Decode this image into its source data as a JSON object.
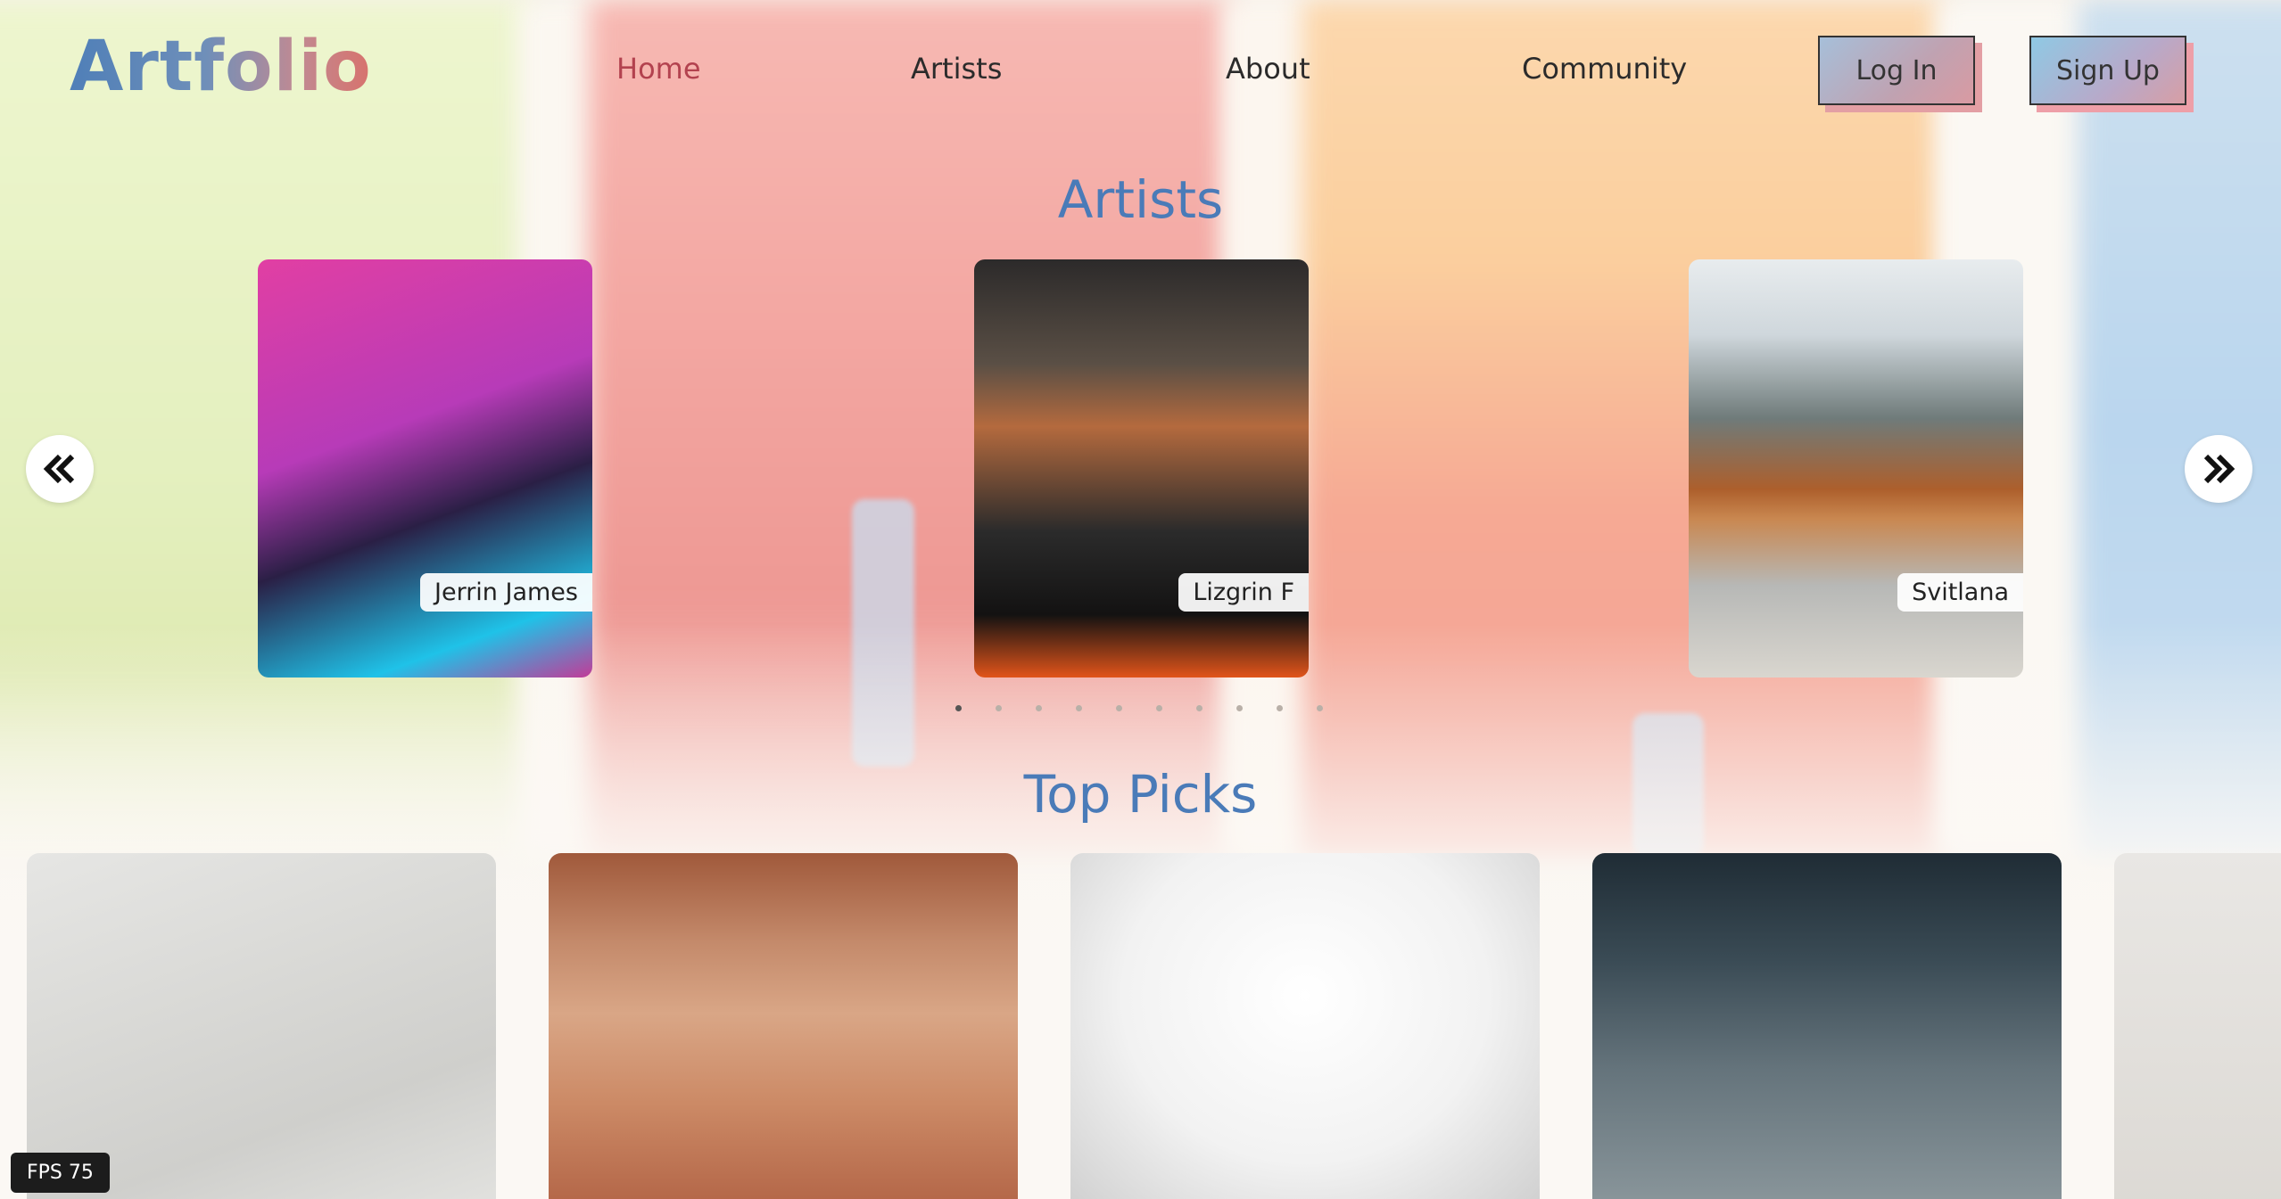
{
  "header": {
    "logo": "Artfolio",
    "nav": [
      "Home",
      "Artists",
      "About",
      "Community"
    ],
    "active_nav": "Home",
    "login_label": "Log In",
    "signup_label": "Sign Up"
  },
  "artists_section": {
    "title": "Artists",
    "cards": [
      {
        "name": "Jerrin James"
      },
      {
        "name": "Lizgrin F"
      },
      {
        "name": "Svitlana"
      }
    ],
    "dot_count": 10,
    "active_dot": 0
  },
  "top_picks": {
    "title": "Top Picks"
  },
  "fps_overlay": "FPS 75",
  "colors": {
    "title_blue": "#4a7bb8",
    "nav_active": "#b3424f"
  },
  "icons": {
    "prev": "double-chevron-left-icon",
    "next": "double-chevron-right-icon"
  }
}
